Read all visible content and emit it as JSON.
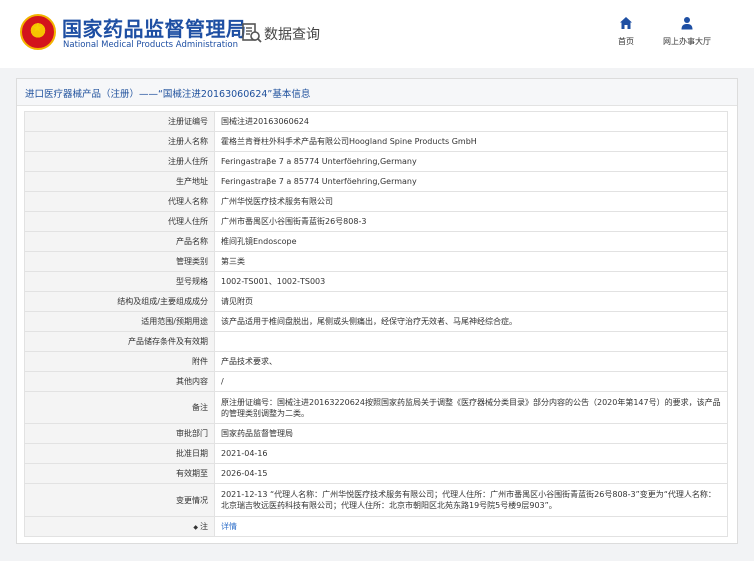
{
  "header": {
    "brand_cn": "国家药品监督管理局",
    "brand_en": "National Medical Products Administration",
    "query_label": "数据查询",
    "nav": [
      {
        "label": "首页",
        "icon": "home-icon"
      },
      {
        "label": "网上办事大厅",
        "icon": "user-icon"
      }
    ]
  },
  "colors": {
    "brand": "#1e4fa3",
    "emblem_red": "#d3141c",
    "emblem_gold": "#f6c400",
    "link": "#2f6fc9"
  },
  "panel": {
    "title": "进口医疗器械产品（注册）——“国械注进20163060624”基本信息"
  },
  "rows": [
    {
      "key": "注册证编号",
      "value": "国械注进20163060624"
    },
    {
      "key": "注册人名称",
      "value": "霍格兰肯脊柱外科手术产品有限公司Hoogland Spine Products GmbH"
    },
    {
      "key": "注册人住所",
      "value": "Feringastraβe 7 a 85774 Unterföehring,Germany"
    },
    {
      "key": "生产地址",
      "value": "Feringastraβe 7 a 85774 Unterföehring,Germany"
    },
    {
      "key": "代理人名称",
      "value": "广州华悦医疗技术服务有限公司"
    },
    {
      "key": "代理人住所",
      "value": "广州市番禺区小谷围街青蓝街26号808-3"
    },
    {
      "key": "产品名称",
      "value": "椎间孔镜Endoscope"
    },
    {
      "key": "管理类别",
      "value": "第三类"
    },
    {
      "key": "型号规格",
      "value": "1002-TS001、1002-TS003"
    },
    {
      "key": "结构及组成/主要组成成分",
      "value": "请见附页"
    },
    {
      "key": "适用范围/预期用途",
      "value": "该产品适用于椎间盘脱出，尾侧或头侧痛出，经保守治疗无效者、马尾神经综合症。"
    },
    {
      "key": "产品储存条件及有效期",
      "value": ""
    },
    {
      "key": "附件",
      "value": "产品技术要求、"
    },
    {
      "key": "其他内容",
      "value": "/"
    },
    {
      "key": "备注",
      "value": "原注册证编号：国械注进20163220624按照国家药监局关于调整《医疗器械分类目录》部分内容的公告（2020年第147号）的要求，该产品的管理类别调整为二类。"
    },
    {
      "key": "审批部门",
      "value": "国家药品监督管理局"
    },
    {
      "key": "批准日期",
      "value": "2021-04-16"
    },
    {
      "key": "有效期至",
      "value": "2026-04-15"
    },
    {
      "key": "变更情况",
      "value": "2021-12-13 “代理人名称：广州华悦医疗技术服务有限公司；代理人住所：广州市番禺区小谷围街青蓝街26号808-3”变更为“代理人名称：北京瑞吉牧远医药科技有限公司；代理人住所：北京市朝阳区北苑东路19号院5号楼9层903”。"
    },
    {
      "key": "注",
      "value": "详情",
      "icon": "bullet-icon"
    }
  ]
}
